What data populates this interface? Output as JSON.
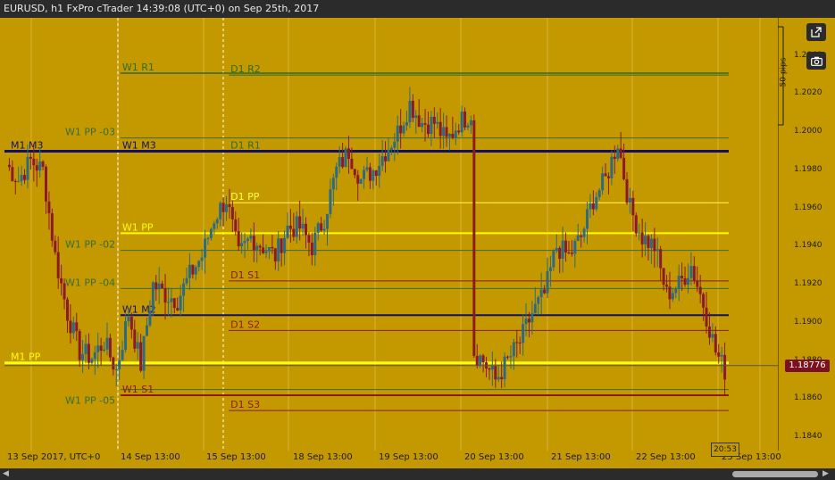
{
  "title": "EURUSD, h1 FxPro cTrader 14:39:08 (UTC+0) on Sep 25th, 2017",
  "colors": {
    "background": "#c49900",
    "bull": "#2e6b80",
    "bear": "#8c1a2a",
    "grid": "#d8b43a"
  },
  "icons": {
    "detach": "external-link-icon",
    "snapshot": "camera-icon"
  },
  "price_axis": {
    "ticks": [
      "1.2040",
      "1.2020",
      "1.2000",
      "1.1980",
      "1.1960",
      "1.1940",
      "1.1920",
      "1.1900",
      "1.1880",
      "1.1860",
      "1.1840"
    ],
    "current_price": "1.18776",
    "pips_label": "50 pips"
  },
  "time_axis": {
    "labels": [
      "13 Sep 2017, UTC+0",
      "14 Sep 13:00",
      "15 Sep 13:00",
      "18 Sep 13:00",
      "19 Sep 13:00",
      "20 Sep 13:00",
      "21 Sep 13:00",
      "22 Sep 13:00",
      "25 Sep 13:00"
    ],
    "countdown": "20:53"
  },
  "levels": [
    {
      "label": "W1 R1",
      "price": 1.2031,
      "color": "#2e6b2e",
      "from": 0.15,
      "width": 1.5
    },
    {
      "label": "D1 R2",
      "price": 1.203,
      "color": "#2e6b2e",
      "from": 0.29,
      "width": 1
    },
    {
      "label": "W1 PP -03",
      "price": 1.1997,
      "color": "#3a6b3a",
      "from": 0.15,
      "width": 1
    },
    {
      "label": "M1 M3",
      "price": 1.199,
      "color": "#10106b",
      "from": 0.0,
      "width": 3
    },
    {
      "label": "W1 M3",
      "price": 1.199,
      "color": "#10106b",
      "from": 0.15,
      "width": 0
    },
    {
      "label": "D1 R1",
      "price": 1.199,
      "color": "#2e6b2e",
      "from": 0.29,
      "width": 0
    },
    {
      "label": "D1 PP",
      "price": 1.1963,
      "color": "#ffff44",
      "from": 0.29,
      "width": 1
    },
    {
      "label": "W1 PP",
      "price": 1.1947,
      "color": "#ffff00",
      "from": 0.15,
      "width": 2
    },
    {
      "label": "W1 PP -02",
      "price": 1.1938,
      "color": "#3a6b3a",
      "from": 0.15,
      "width": 1
    },
    {
      "label": "D1 S1",
      "price": 1.1922,
      "color": "#8c1a1a",
      "from": 0.29,
      "width": 1
    },
    {
      "label": "W1 PP -04",
      "price": 1.1918,
      "color": "#3a6b3a",
      "from": 0.15,
      "width": 1
    },
    {
      "label": "W1 M2",
      "price": 1.1904,
      "color": "#10106b",
      "from": 0.15,
      "width": 2
    },
    {
      "label": "D1 S2",
      "price": 1.1896,
      "color": "#8c1a1a",
      "from": 0.29,
      "width": 1
    },
    {
      "label": "M1 PP",
      "price": 1.1879,
      "color": "#ffff00",
      "from": 0.0,
      "width": 3
    },
    {
      "label": "W1 PP -05",
      "price": 1.1865,
      "color": "#3a6b3a",
      "from": 0.15,
      "width": 1
    },
    {
      "label": "W1 S1",
      "price": 1.1862,
      "color": "#8c1a1a",
      "from": 0.15,
      "width": 2
    },
    {
      "label": "D1 S3",
      "price": 1.1854,
      "color": "#8c1a1a",
      "from": 0.29,
      "width": 1
    }
  ],
  "chart_data": {
    "type": "candlestick",
    "ylim": [
      1.1833,
      1.206
    ],
    "anchors": [
      [
        0,
        1.1983
      ],
      [
        4,
        1.1975
      ],
      [
        8,
        1.1985
      ],
      [
        12,
        1.198
      ],
      [
        16,
        1.1935
      ],
      [
        20,
        1.1905
      ],
      [
        24,
        1.1885
      ],
      [
        28,
        1.1882
      ],
      [
        32,
        1.189
      ],
      [
        36,
        1.1875
      ],
      [
        40,
        1.1905
      ],
      [
        44,
        1.1878
      ],
      [
        48,
        1.192
      ],
      [
        52,
        1.1915
      ],
      [
        56,
        1.1912
      ],
      [
        60,
        1.1925
      ],
      [
        64,
        1.1935
      ],
      [
        68,
        1.1955
      ],
      [
        72,
        1.1965
      ],
      [
        76,
        1.1935
      ],
      [
        80,
        1.1945
      ],
      [
        84,
        1.194
      ],
      [
        88,
        1.1935
      ],
      [
        92,
        1.195
      ],
      [
        96,
        1.195
      ],
      [
        100,
        1.194
      ],
      [
        104,
        1.1955
      ],
      [
        108,
        1.198
      ],
      [
        112,
        1.199
      ],
      [
        116,
        1.1975
      ],
      [
        120,
        1.198
      ],
      [
        124,
        1.199
      ],
      [
        128,
        1.2
      ],
      [
        132,
        1.2015
      ],
      [
        136,
        1.2005
      ],
      [
        140,
        1.2005
      ],
      [
        144,
        1.1995
      ],
      [
        148,
        1.2005
      ],
      [
        152,
        1.201
      ],
      [
        153,
        1.1885
      ],
      [
        156,
        1.188
      ],
      [
        160,
        1.187
      ],
      [
        164,
        1.188
      ],
      [
        168,
        1.189
      ],
      [
        172,
        1.1905
      ],
      [
        176,
        1.1915
      ],
      [
        180,
        1.194
      ],
      [
        184,
        1.1935
      ],
      [
        188,
        1.1945
      ],
      [
        192,
        1.1965
      ],
      [
        196,
        1.1975
      ],
      [
        200,
        1.1995
      ],
      [
        204,
        1.196
      ],
      [
        208,
        1.1945
      ],
      [
        212,
        1.194
      ],
      [
        216,
        1.1915
      ],
      [
        220,
        1.192
      ],
      [
        224,
        1.193
      ],
      [
        228,
        1.191
      ],
      [
        232,
        1.1885
      ],
      [
        235,
        1.1875
      ]
    ]
  }
}
